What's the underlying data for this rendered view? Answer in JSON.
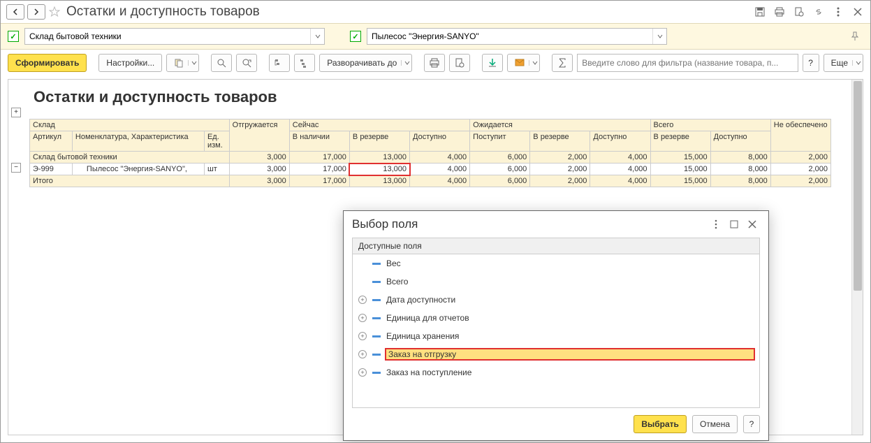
{
  "title": "Остатки и доступность товаров",
  "filter": {
    "warehouse": "Склад бытовой техники",
    "product": "Пылесос \"Энергия-SANYO\""
  },
  "toolbar": {
    "generate": "Сформировать",
    "settings": "Настройки...",
    "expand_to": "Разворачивать до",
    "filter_placeholder": "Введите слово для фильтра (название товара, п...",
    "more": "Еще"
  },
  "report": {
    "title": "Остатки и доступность товаров",
    "headers": {
      "warehouse": "Склад",
      "article": "Артикул",
      "nomenclature": "Номенклатура, Характеристика",
      "unit": "Ед. изм.",
      "now": "Сейчас",
      "expected": "Ожидается",
      "total": "Всего",
      "shipped": "Отгружается",
      "in_stock": "В наличии",
      "reserved": "В резерве",
      "available": "Доступно",
      "incoming": "Поступит",
      "not_secured": "Не обеспечено"
    },
    "group_row": {
      "name": "Склад бытовой техники",
      "shipped": "3,000",
      "in_stock": "17,000",
      "reserved": "13,000",
      "available": "4,000",
      "incoming": "6,000",
      "exp_reserved": "2,000",
      "exp_available": "4,000",
      "tot_reserved": "15,000",
      "tot_available": "8,000",
      "not_secured": "2,000"
    },
    "data_row": {
      "article": "Э-999",
      "name": "Пылесос \"Энергия-SANYO\",",
      "unit": "шт",
      "shipped": "3,000",
      "in_stock": "17,000",
      "reserved": "13,000",
      "available": "4,000",
      "incoming": "6,000",
      "exp_reserved": "2,000",
      "exp_available": "4,000",
      "tot_reserved": "15,000",
      "tot_available": "8,000",
      "not_secured": "2,000"
    },
    "total_row": {
      "name": "Итого",
      "shipped": "3,000",
      "in_stock": "17,000",
      "reserved": "13,000",
      "available": "4,000",
      "incoming": "6,000",
      "exp_reserved": "2,000",
      "exp_available": "4,000",
      "tot_reserved": "15,000",
      "tot_available": "8,000",
      "not_secured": "2,000"
    }
  },
  "dialog": {
    "title": "Выбор поля",
    "header": "Доступные поля",
    "fields": [
      {
        "name": "Вес",
        "exp": false
      },
      {
        "name": "Всего",
        "exp": false
      },
      {
        "name": "Дата доступности",
        "exp": true
      },
      {
        "name": "Единица для отчетов",
        "exp": true
      },
      {
        "name": "Единица хранения",
        "exp": true
      },
      {
        "name": "Заказ на отгрузку",
        "exp": true,
        "sel": true
      },
      {
        "name": "Заказ на поступление",
        "exp": true
      }
    ],
    "select": "Выбрать",
    "cancel": "Отмена"
  }
}
